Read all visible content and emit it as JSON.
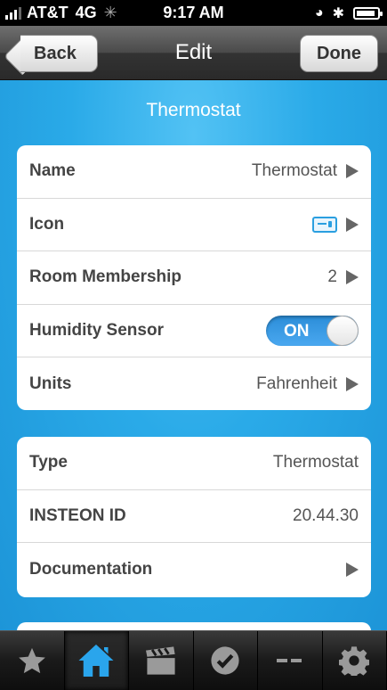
{
  "status_bar": {
    "carrier": "AT&T",
    "network": "4G",
    "time": "9:17 AM"
  },
  "nav": {
    "back_label": "Back",
    "title": "Edit",
    "done_label": "Done"
  },
  "section": {
    "title": "Thermostat"
  },
  "settings": {
    "name_label": "Name",
    "name_value": "Thermostat",
    "icon_label": "Icon",
    "room_label": "Room Membership",
    "room_value": "2",
    "humidity_label": "Humidity Sensor",
    "humidity_toggle": "ON",
    "units_label": "Units",
    "units_value": "Fahrenheit"
  },
  "info": {
    "type_label": "Type",
    "type_value": "Thermostat",
    "insteon_label": "INSTEON ID",
    "insteon_value": "20.44.30",
    "doc_label": "Documentation"
  },
  "tabs": [
    "favorites-icon",
    "home-icon",
    "scenes-icon",
    "status-icon",
    "more-icon",
    "settings-icon"
  ],
  "colors": {
    "accent": "#2aaae8",
    "tab_active": "#2aa5ec"
  }
}
